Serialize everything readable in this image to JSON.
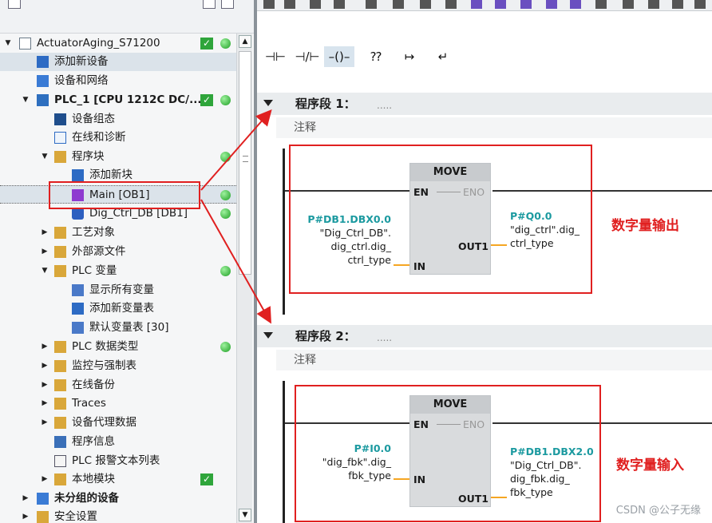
{
  "tree": {
    "items": [
      {
        "label": "ActuatorAging_S71200"
      },
      {
        "label": "添加新设备"
      },
      {
        "label": "设备和网络"
      },
      {
        "label": "PLC_1 [CPU 1212C DC/..."
      },
      {
        "label": "设备组态"
      },
      {
        "label": "在线和诊断"
      },
      {
        "label": "程序块"
      },
      {
        "label": "添加新块"
      },
      {
        "label": "Main [OB1]"
      },
      {
        "label": "Dig_Ctrl_DB [DB1]"
      },
      {
        "label": "工艺对象"
      },
      {
        "label": "外部源文件"
      },
      {
        "label": "PLC 变量"
      },
      {
        "label": "显示所有变量"
      },
      {
        "label": "添加新变量表"
      },
      {
        "label": "默认变量表 [30]"
      },
      {
        "label": "PLC 数据类型"
      },
      {
        "label": "监控与强制表"
      },
      {
        "label": "在线备份"
      },
      {
        "label": "Traces"
      },
      {
        "label": "设备代理数据"
      },
      {
        "label": "程序信息"
      },
      {
        "label": "PLC 报警文本列表"
      },
      {
        "label": "本地模块"
      },
      {
        "label": "未分组的设备"
      },
      {
        "label": "安全设置"
      }
    ]
  },
  "ladder_toolbar": {
    "no_contact": "⊣⊢",
    "nc_contact": "⊣/⊢",
    "coil": "–()–",
    "empty_box": "⁇",
    "open_branch": "↦",
    "close_branch": "↵"
  },
  "networks": [
    {
      "title": "程序段 1：",
      "dots": ".....",
      "comment": "注释",
      "block": {
        "name": "MOVE",
        "en": "EN",
        "eno": "ENO",
        "in": "IN",
        "out": "OUT1"
      },
      "in_operand": {
        "addr": "P#DB1.DBX0.0",
        "l1": "\"Dig_Ctrl_DB\".",
        "l2": "dig_ctrl.dig_",
        "l3": "ctrl_type"
      },
      "out_operand": {
        "addr": "P#Q0.0",
        "l1": "\"dig_ctrl\".dig_",
        "l2": "ctrl_type"
      },
      "annotation": "数字量输出"
    },
    {
      "title": "程序段 2：",
      "dots": ".....",
      "comment": "注释",
      "block": {
        "name": "MOVE",
        "en": "EN",
        "eno": "ENO",
        "in": "IN",
        "out": "OUT1"
      },
      "in_operand": {
        "addr": "P#I0.0",
        "l1": "\"dig_fbk\".dig_",
        "l2": "fbk_type"
      },
      "out_operand": {
        "addr": "P#DB1.DBX2.0",
        "l1": "\"Dig_Ctrl_DB\".",
        "l2": "dig_fbk.dig_",
        "l3": "fbk_type"
      },
      "annotation": "数字量输入"
    }
  ],
  "watermark": "CSDN @公子无缘",
  "colors": {
    "accent_red": "#e02020",
    "address_teal": "#1c9aa0",
    "wire_orange": "#f5a623",
    "status_green": "#2fa53b"
  }
}
